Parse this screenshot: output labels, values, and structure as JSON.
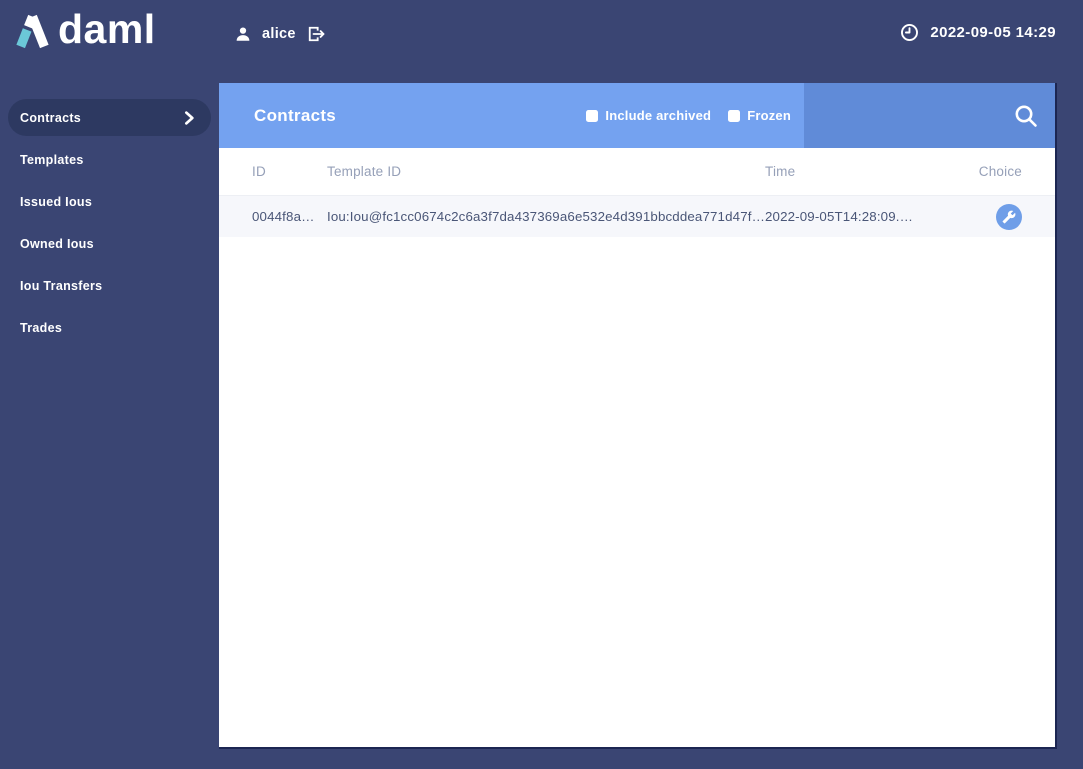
{
  "colors": {
    "chrome_navy": "#3A4573",
    "active_pill_navy": "#2D3961",
    "panel_header_blue": "#74A2F0",
    "search_section_blue": "#608BD8",
    "choice_button_blue": "#6F9EE8",
    "logo_accent_teal": "#6BC8D8",
    "table_header_text": "#96A0B8",
    "row_text": "#4A5677",
    "row_background": "#F6F7FB",
    "content_edge": "#1C2652"
  },
  "icons": {
    "logo_mark": "daml-lambda-icon",
    "user": "person-icon",
    "signout": "logout-icon",
    "ledger_time": "clock-icon",
    "active_nav": "chevron-right-icon",
    "search": "search-icon",
    "choice": "wrench-icon",
    "filter_box": "checkbox-unchecked"
  },
  "topbar": {
    "logo_text": "daml",
    "user_name": "alice",
    "timestamp": "2022-09-05 14:29"
  },
  "sidebar": {
    "items": [
      {
        "label": "Contracts",
        "active": true
      },
      {
        "label": "Templates",
        "active": false
      },
      {
        "label": "Issued Ious",
        "active": false
      },
      {
        "label": "Owned Ious",
        "active": false
      },
      {
        "label": "Iou Transfers",
        "active": false
      },
      {
        "label": "Trades",
        "active": false
      }
    ]
  },
  "main": {
    "title": "Contracts",
    "filters": [
      {
        "label": "Include archived",
        "checked": false
      },
      {
        "label": "Frozen",
        "checked": false
      }
    ],
    "table": {
      "columns": [
        "ID",
        "Template ID",
        "Time",
        "Choice"
      ],
      "rows": [
        {
          "id": "0044f8a…",
          "template_id": "Iou:Iou@fc1cc0674c2c6a3f7da437369a6e532e4d391bbcddea771d47f…",
          "time": "2022-09-05T14:28:09.…",
          "choice": "wrench-icon"
        }
      ]
    }
  }
}
